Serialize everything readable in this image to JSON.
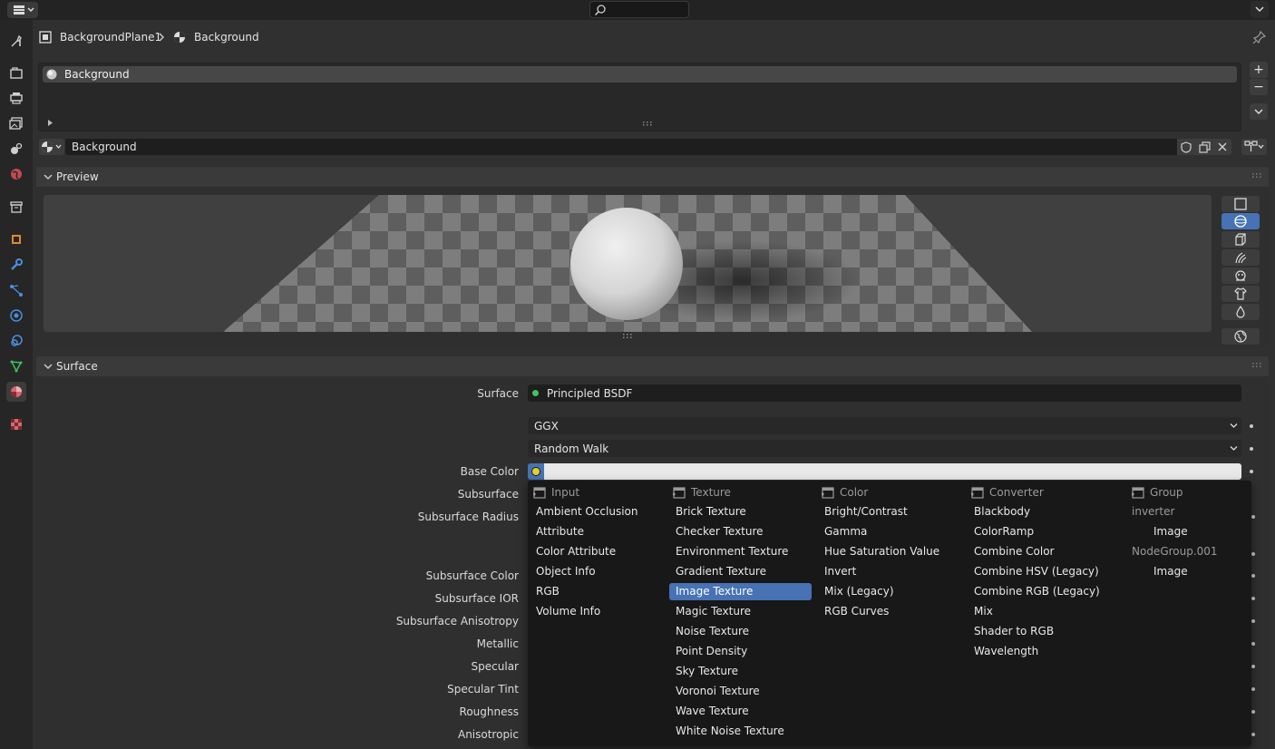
{
  "breadcrumb": {
    "object": "BackgroundPlane1",
    "material": "Background"
  },
  "material_slots": {
    "items": [
      "Background"
    ]
  },
  "material_selector": {
    "name": "Background"
  },
  "preview_panel": {
    "title": "Preview"
  },
  "surface_panel": {
    "title": "Surface",
    "surface_label": "Surface",
    "surface_value": "Principled BSDF",
    "distribution": "GGX",
    "subsurface_method": "Random Walk",
    "base_color_label": "Base Color",
    "base_color": "#e8e8e8",
    "labels": [
      "Subsurface",
      "Subsurface Radius",
      "Subsurface Color",
      "Subsurface IOR",
      "Subsurface Anisotropy",
      "Metallic",
      "Specular",
      "Specular Tint",
      "Roughness",
      "Anisotropic"
    ]
  },
  "node_menu": {
    "columns": [
      {
        "header": "Input",
        "items": [
          "Ambient Occlusion",
          "Attribute",
          "Color Attribute",
          "Object Info",
          "RGB",
          "Volume Info"
        ]
      },
      {
        "header": "Texture",
        "items": [
          "Brick Texture",
          "Checker Texture",
          "Environment Texture",
          "Gradient Texture",
          "Image Texture",
          "Magic Texture",
          "Noise Texture",
          "Point Density",
          "Sky Texture",
          "Voronoi Texture",
          "Wave Texture",
          "White Noise Texture"
        ]
      },
      {
        "header": "Color",
        "items": [
          "Bright/Contrast",
          "Gamma",
          "Hue Saturation Value",
          "Invert",
          "Mix (Legacy)",
          "RGB Curves"
        ]
      },
      {
        "header": "Converter",
        "items": [
          "Blackbody",
          "ColorRamp",
          "Combine Color",
          "Combine HSV (Legacy)",
          "Combine RGB (Legacy)",
          "Mix",
          "Shader to RGB",
          "Wavelength"
        ]
      },
      {
        "header": "Group",
        "items": [
          "inverter",
          "Image",
          "NodeGroup.001",
          "Image"
        ]
      }
    ],
    "selected": "Image Texture"
  },
  "colors": {
    "accent": "#4772b3",
    "surface_dot": "#44c060",
    "base_color_dot": "#e5d02a"
  }
}
